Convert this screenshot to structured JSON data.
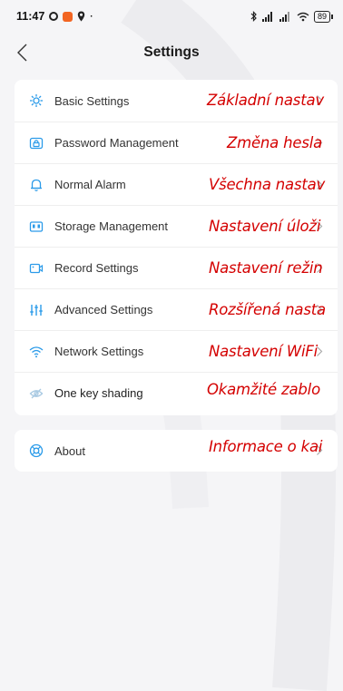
{
  "status_bar": {
    "time": "11:47",
    "battery": "89"
  },
  "header": {
    "title": "Settings"
  },
  "menu": {
    "items": [
      {
        "label": "Basic Settings",
        "overlay": "Základní nastav",
        "icon": "gear-icon"
      },
      {
        "label": "Password Management",
        "overlay": "Změna hesla",
        "icon": "password-icon"
      },
      {
        "label": "Normal Alarm",
        "overlay": "Všechna nastav",
        "icon": "bell-icon"
      },
      {
        "label": "Storage Management",
        "overlay": "Nastavení úloži",
        "icon": "storage-icon"
      },
      {
        "label": "Record Settings",
        "overlay": "Nastavení režin",
        "icon": "record-icon"
      },
      {
        "label": "Advanced Settings",
        "overlay": "Rozšířená nasta",
        "icon": "sliders-icon"
      },
      {
        "label": "Network Settings",
        "overlay": "Nastavení WiFi",
        "icon": "wifi-icon"
      },
      {
        "label": "One key shading",
        "overlay": "Okamžité zablo",
        "icon": "eye-off-icon"
      }
    ]
  },
  "about": {
    "label": "About",
    "overlay": "Informace o kai",
    "icon": "about-icon"
  },
  "colors": {
    "background": "#f5f5f7",
    "card": "#ffffff",
    "overlay_text": "#d40000",
    "icon": "#2b9be9"
  }
}
